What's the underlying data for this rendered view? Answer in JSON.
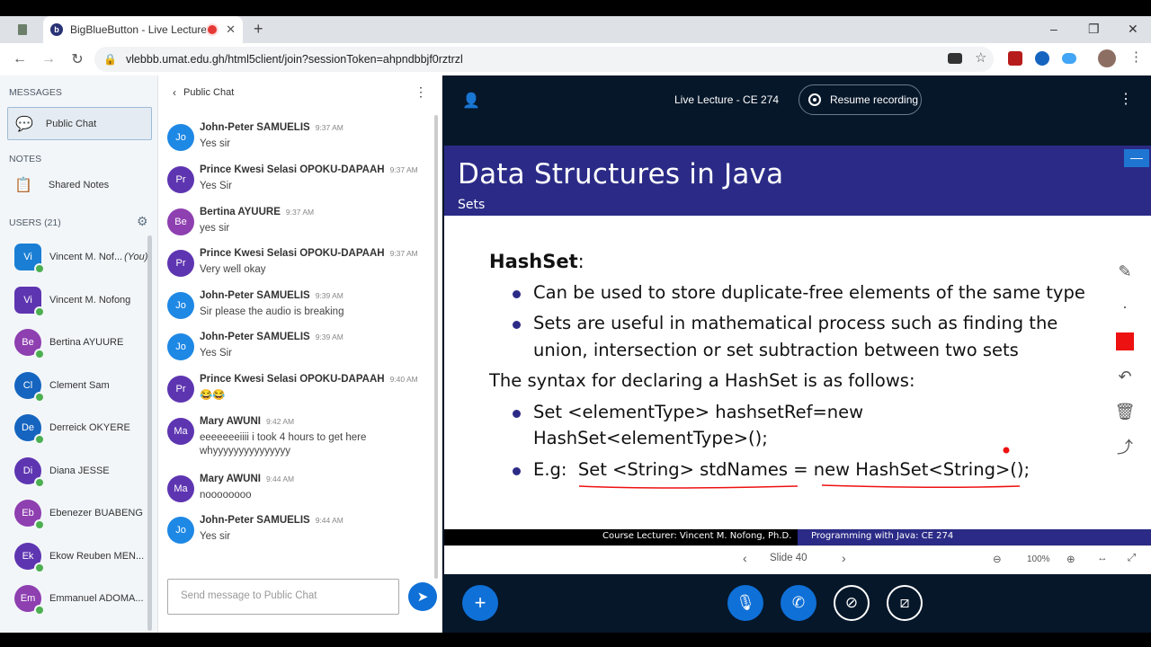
{
  "browser": {
    "tab_title": "BigBlueButton - Live Lecture",
    "tab_favicon": "b",
    "url": "vlebbb.umat.edu.gh/html5client/join?sessionToken=ahpndbbjf0rztrzl"
  },
  "sidebar": {
    "messages_header": "MESSAGES",
    "public_chat": "Public Chat",
    "notes_header": "NOTES",
    "shared_notes": "Shared Notes",
    "users_header": "USERS (21)",
    "users": [
      {
        "initials": "Vi",
        "name": "Vincent M. Nof...",
        "you": "(You)",
        "color": "#1a7fd4"
      },
      {
        "initials": "Vi",
        "name": "Vincent M. Nofong",
        "color": "#5e35b1"
      },
      {
        "initials": "Be",
        "name": "Bertina AYUURE",
        "color": "#8e3fb0"
      },
      {
        "initials": "Cl",
        "name": "Clement Sam",
        "color": "#1565c0"
      },
      {
        "initials": "De",
        "name": "Derreick OKYERE",
        "color": "#1565c0"
      },
      {
        "initials": "Di",
        "name": "Diana JESSE",
        "color": "#5e35b1"
      },
      {
        "initials": "Eb",
        "name": "Ebenezer BUABENG",
        "color": "#8e3fb0"
      },
      {
        "initials": "Ek",
        "name": "Ekow Reuben MEN...",
        "color": "#5e35b1"
      },
      {
        "initials": "Em",
        "name": "Emmanuel ADOMA...",
        "color": "#8e3fb0"
      }
    ]
  },
  "chat": {
    "header": "Public Chat",
    "messages": [
      {
        "initials": "Pr",
        "name": "",
        "time": "",
        "text": "Yes Sir",
        "color": "#5e35b1"
      },
      {
        "initials": "Jo",
        "name": "John-Peter SAMUELIS",
        "time": "9:37 AM",
        "text": "Yes sir",
        "color": "#1e88e5"
      },
      {
        "initials": "Pr",
        "name": "Prince Kwesi Selasi OPOKU-DAPAAH",
        "time": "9:37 AM",
        "text": "Yes Sir",
        "color": "#5e35b1"
      },
      {
        "initials": "Be",
        "name": "Bertina AYUURE",
        "time": "9:37 AM",
        "text": "yes sir",
        "color": "#8e3fb0"
      },
      {
        "initials": "Pr",
        "name": "Prince Kwesi Selasi OPOKU-DAPAAH",
        "time": "9:37 AM",
        "text": "Very well okay",
        "color": "#5e35b1"
      },
      {
        "initials": "Jo",
        "name": "John-Peter SAMUELIS",
        "time": "9:39 AM",
        "text": "Sir please the audio is breaking",
        "color": "#1e88e5"
      },
      {
        "initials": "Jo",
        "name": "John-Peter SAMUELIS",
        "time": "9:39 AM",
        "text": "Yes Sir",
        "color": "#1e88e5"
      },
      {
        "initials": "Pr",
        "name": "Prince Kwesi Selasi OPOKU-DAPAAH",
        "time": "9:40 AM",
        "text": "😂😂",
        "color": "#5e35b1"
      },
      {
        "initials": "Ma",
        "name": "Mary AWUNI",
        "time": "9:42 AM",
        "text": "eeeeeeeiiii i took 4 hours to get here whyyyyyyyyyyyyyyy",
        "color": "#5e35b1"
      },
      {
        "initials": "Ma",
        "name": "Mary AWUNI",
        "time": "9:44 AM",
        "text": "noooooooo",
        "color": "#5e35b1"
      },
      {
        "initials": "Jo",
        "name": "John-Peter SAMUELIS",
        "time": "9:44 AM",
        "text": "Yes sir",
        "color": "#1e88e5"
      }
    ],
    "input_placeholder": "Send message to Public Chat"
  },
  "presentation": {
    "meeting_title": "Live Lecture - CE 274",
    "record_label": "Resume recording",
    "slide": {
      "title": "Data Structures in Java",
      "subtitle": "Sets",
      "heading": "HashSet",
      "heading_colon": ":",
      "bullet1": "Can be used to store duplicate-free elements of the same type",
      "bullet2_l1": "Sets are useful in mathematical process such as finding the",
      "bullet2_l2": "union, intersection or set subtraction between two sets",
      "line3": "The syntax for declaring a HashSet is as follows:",
      "bullet3_l1": "Set <elementType> hashsetRef=new",
      "bullet3_l2": "HashSet<elementType>();",
      "bullet4": "E.g:  Set <String> stdNames = new HashSet<String>();",
      "footer_left": "Course Lecturer:  Vincent M. Nofong, Ph.D.",
      "footer_right": "Programming with Java:  CE 274"
    },
    "slide_label": "Slide 40",
    "zoom": "100%"
  },
  "colors": {
    "accent": "#0f70d7",
    "slide_band": "#2b2b87",
    "presenter_bg": "#06172a",
    "pen": "#ee1111"
  }
}
